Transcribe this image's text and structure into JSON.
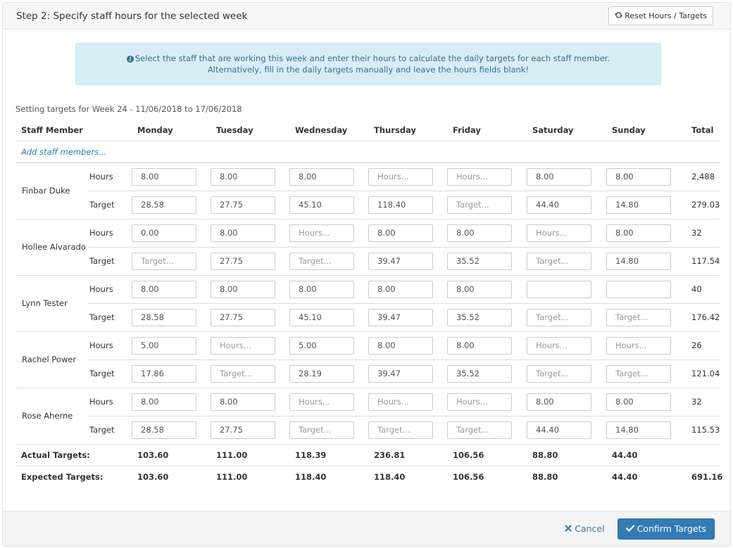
{
  "header": {
    "title": "Step 2: Specify staff hours for the selected week",
    "reset_label": "Reset Hours / Targets",
    "reset_icon": "refresh-icon"
  },
  "info": {
    "icon": "info-circle-icon",
    "line1": "Select the staff that are working this week and enter their hours to calculate the daily targets for each staff member.",
    "line2": "Alternatively, fill in the daily targets manually and leave the hours fields blank!"
  },
  "week_label": "Setting targets for Week 24 - 11/06/2018 to 17/06/2018",
  "table": {
    "columns": [
      "Staff Member",
      "Monday",
      "Tuesday",
      "Wednesday",
      "Thursday",
      "Friday",
      "Saturday",
      "Sunday",
      "Total"
    ],
    "add_staff_label": "Add staff members...",
    "hours_label": "Hours",
    "target_label": "Target",
    "hours_placeholder": "Hours...",
    "target_placeholder": "Target...",
    "staff": [
      {
        "name": "Finbar Duke",
        "hours": [
          "8.00",
          "8.00",
          "8.00",
          "",
          "",
          "8.00",
          "8.00"
        ],
        "hours_placeholder_shown": [
          false,
          false,
          false,
          true,
          true,
          false,
          false
        ],
        "hours_total": "2,488",
        "targets": [
          "28.58",
          "27.75",
          "45.10",
          "118.40",
          "",
          "44.40",
          "14.80"
        ],
        "targets_placeholder_shown": [
          false,
          false,
          false,
          false,
          true,
          false,
          false
        ],
        "target_total": "279.03"
      },
      {
        "name": "Hollee Alvarado",
        "hours": [
          "0.00",
          "8.00",
          "",
          "8.00",
          "8.00",
          "",
          "8.00"
        ],
        "hours_placeholder_shown": [
          false,
          false,
          true,
          false,
          false,
          true,
          false
        ],
        "hours_total": "32",
        "targets": [
          "",
          "27.75",
          "",
          "39.47",
          "35.52",
          "",
          "14.80"
        ],
        "targets_placeholder_shown": [
          true,
          false,
          true,
          false,
          false,
          true,
          false
        ],
        "target_total": "117.54"
      },
      {
        "name": "Lynn Tester",
        "hours": [
          "8.00",
          "8.00",
          "8.00",
          "8.00",
          "8.00",
          "",
          ""
        ],
        "hours_placeholder_shown": [
          false,
          false,
          false,
          false,
          false,
          false,
          false
        ],
        "hours_total": "40",
        "targets": [
          "28.58",
          "27.75",
          "45.10",
          "39.47",
          "35.52",
          "",
          ""
        ],
        "targets_placeholder_shown": [
          false,
          false,
          false,
          false,
          false,
          true,
          true
        ],
        "target_total": "176.42"
      },
      {
        "name": "Rachel Power",
        "hours": [
          "5.00",
          "",
          "5.00",
          "8.00",
          "8.00",
          "",
          ""
        ],
        "hours_placeholder_shown": [
          false,
          true,
          false,
          false,
          false,
          true,
          true
        ],
        "hours_total": "26",
        "targets": [
          "17.86",
          "",
          "28.19",
          "39.47",
          "35.52",
          "",
          ""
        ],
        "targets_placeholder_shown": [
          false,
          true,
          false,
          false,
          false,
          true,
          true
        ],
        "target_total": "121.04"
      },
      {
        "name": "Rose Aherne",
        "hours": [
          "8.00",
          "8.00",
          "",
          "",
          "",
          "8.00",
          "8.00"
        ],
        "hours_placeholder_shown": [
          false,
          false,
          true,
          true,
          true,
          false,
          false
        ],
        "hours_total": "32",
        "targets": [
          "28.58",
          "27.75",
          "",
          "",
          "",
          "44.40",
          "14.80"
        ],
        "targets_placeholder_shown": [
          false,
          false,
          true,
          true,
          true,
          false,
          false
        ],
        "target_total": "115.53"
      }
    ],
    "actual": {
      "label": "Actual Targets:",
      "values": [
        "103.60",
        "111.00",
        "118.39",
        "236.81",
        "106.56",
        "88.80",
        "44.40"
      ],
      "total": ""
    },
    "expected": {
      "label": "Expected Targets:",
      "values": [
        "103.60",
        "111.00",
        "118.40",
        "118.40",
        "106.56",
        "88.80",
        "44.40"
      ],
      "total": "691.16"
    }
  },
  "footer": {
    "cancel_label": "Cancel",
    "cancel_icon": "times-icon",
    "confirm_label": "Confirm Targets",
    "confirm_icon": "check-icon"
  },
  "colors": {
    "primary": "#337ab7",
    "info_bg": "#d9edf7",
    "info_text": "#31708f"
  }
}
